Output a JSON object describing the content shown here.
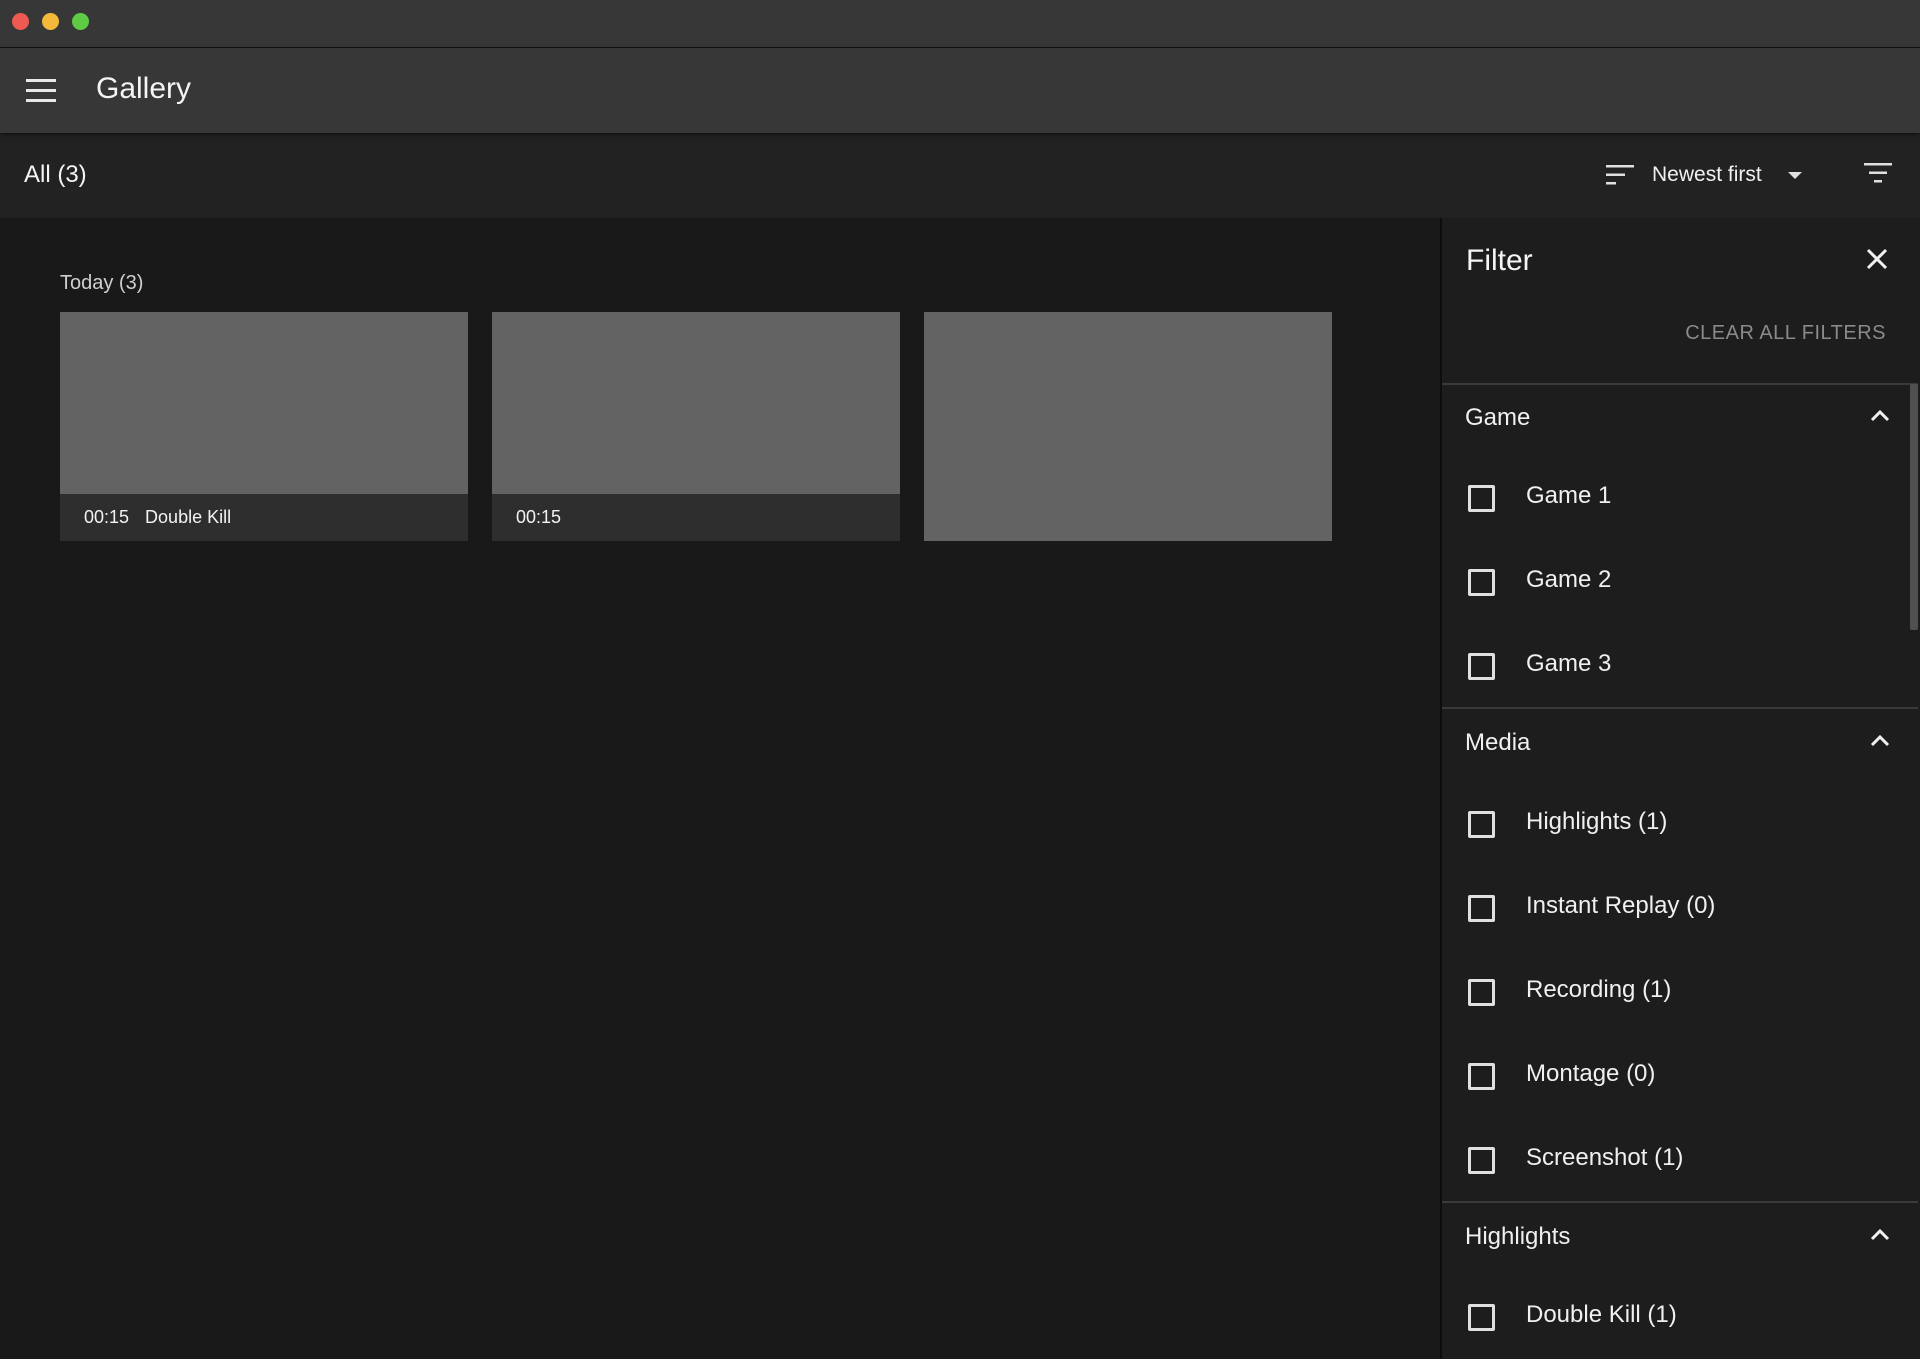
{
  "window": {
    "title": ""
  },
  "appbar": {
    "title": "Gallery"
  },
  "toolbar": {
    "count_label": "All (3)",
    "sort_label": "Newest first"
  },
  "gallery": {
    "section_label": "Today (3)",
    "items": [
      {
        "duration": "00:15",
        "title": "Double Kill"
      },
      {
        "duration": "00:15",
        "title": ""
      },
      {
        "duration": "",
        "title": ""
      }
    ]
  },
  "filter": {
    "title": "Filter",
    "clear_all": "CLEAR ALL FILTERS",
    "groups": [
      {
        "title": "Game",
        "options": [
          "Game 1",
          "Game 2",
          "Game 3"
        ]
      },
      {
        "title": "Media",
        "options": [
          "Highlights (1)",
          "Instant Replay (0)",
          "Recording (1)",
          "Montage (0)",
          "Screenshot (1)"
        ]
      },
      {
        "title": "Highlights",
        "options": [
          "Double Kill (1)"
        ]
      }
    ]
  },
  "colors": {
    "background": "#191919",
    "appbar": "#373737",
    "toolbar": "#222222",
    "thumbnail": "#636363",
    "caption": "#2e2e2e",
    "panel": "#1d1d1d",
    "muted_text": "#8a8a8a"
  },
  "icons": [
    "menu-icon",
    "sort-icon",
    "caret-down-icon",
    "filter-icon",
    "close-icon",
    "chevron-up-icon",
    "checkbox-icon"
  ]
}
